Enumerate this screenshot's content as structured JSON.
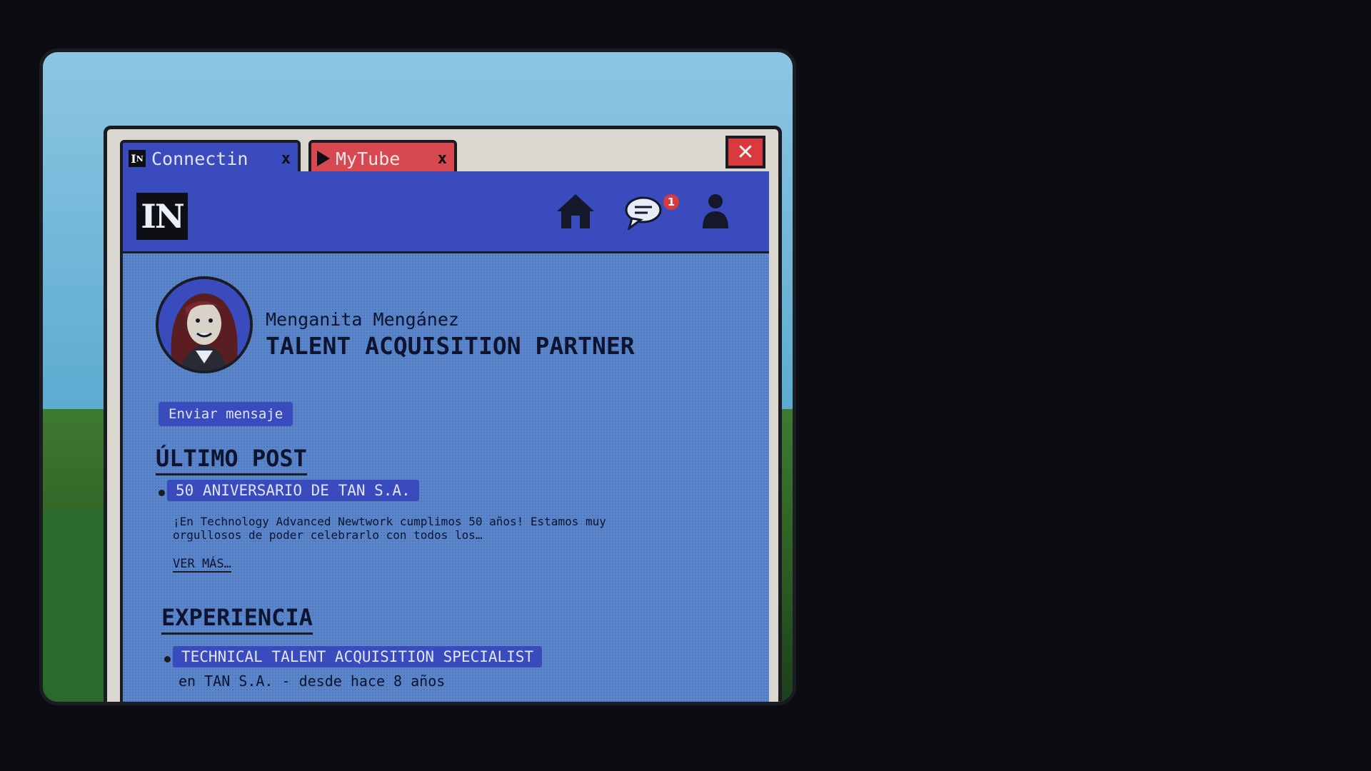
{
  "tabs": [
    {
      "label": "Connectin",
      "icon": "connectin-logo-icon",
      "close": "x"
    },
    {
      "label": "MyTube",
      "icon": "play-icon",
      "close": "x"
    }
  ],
  "window": {
    "close_icon": "close-icon",
    "close_glyph": "✕"
  },
  "navbar": {
    "brand": "IN",
    "icons": [
      "home-icon",
      "chat-icon",
      "user-icon"
    ],
    "notification_count": "1"
  },
  "profile": {
    "name": "Menganita Mengánez",
    "title": "TALENT ACQUISITION PARTNER",
    "message_button": "Enviar mensaje"
  },
  "latest_post": {
    "heading": "ÚLTIMO POST",
    "title": "50 ANIVERSARIO DE TAN S.A.",
    "text": "¡En Technology Advanced Newtwork cumplimos 50 años! Estamos muy orgullosos de poder celebrarlo con todos los…",
    "read_more": "VER MÁS…"
  },
  "experience": {
    "heading": "EXPERIENCIA",
    "job_title": "TECHNICAL TALENT ACQUISITION SPECIALIST",
    "job_detail": "en TAN S.A. - desde hace 8 años"
  },
  "colors": {
    "nav_blue": "#3a4bbd",
    "page_blue": "#5a86cc",
    "tab_red": "#d84850",
    "close_red": "#d83a3e"
  }
}
